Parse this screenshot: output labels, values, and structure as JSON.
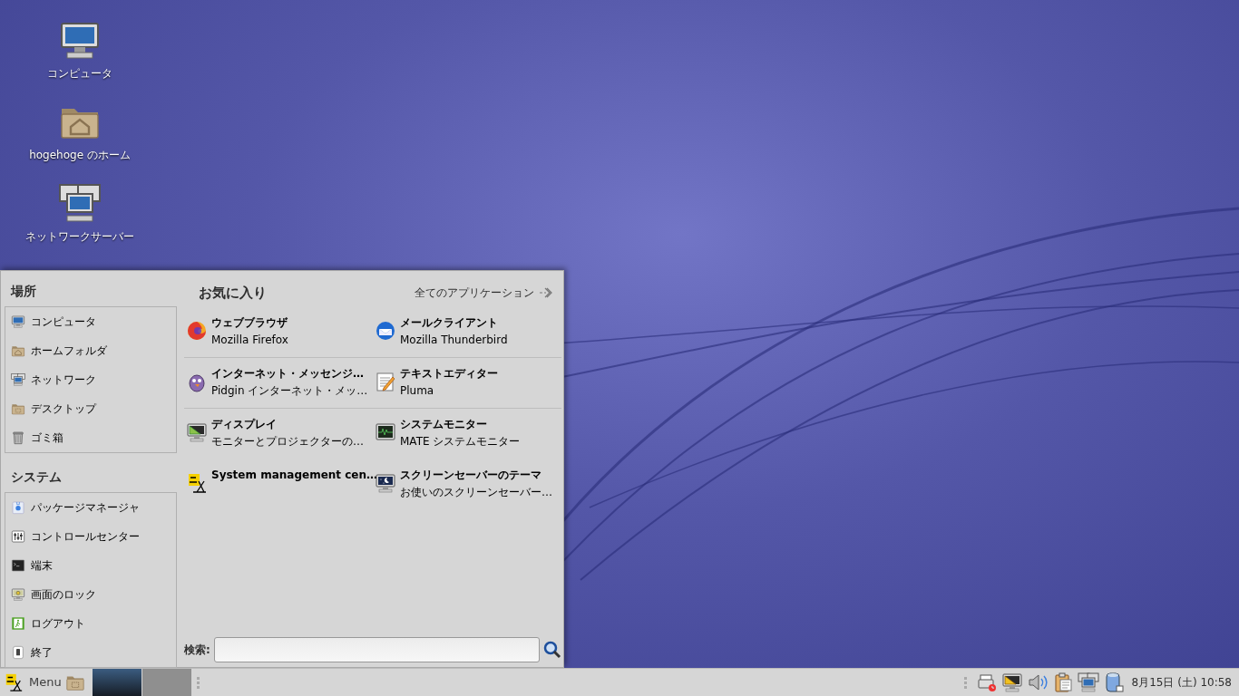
{
  "desktop_icons": [
    {
      "label": "コンピュータ",
      "kind": "computer"
    },
    {
      "label": "hogehoge のホーム",
      "kind": "home"
    },
    {
      "label": "ネットワークサーバー",
      "kind": "network"
    }
  ],
  "menu": {
    "places_title": "場所",
    "places": [
      {
        "label": "コンピュータ",
        "kind": "computer"
      },
      {
        "label": "ホームフォルダ",
        "kind": "home"
      },
      {
        "label": "ネットワーク",
        "kind": "network"
      },
      {
        "label": "デスクトップ",
        "kind": "desktop"
      },
      {
        "label": "ゴミ箱",
        "kind": "trash"
      }
    ],
    "system_title": "システム",
    "system": [
      {
        "label": "パッケージマネージャ",
        "kind": "package"
      },
      {
        "label": "コントロールセンター",
        "kind": "control"
      },
      {
        "label": "端末",
        "kind": "terminal"
      },
      {
        "label": "画面のロック",
        "kind": "lock"
      },
      {
        "label": "ログアウト",
        "kind": "logout"
      },
      {
        "label": "終了",
        "kind": "power"
      }
    ],
    "favorites_title": "お気に入り",
    "all_apps_link": "全てのアプリケーション",
    "favorite_rows": [
      {
        "divider": true,
        "items": [
          {
            "title": "ウェブブラウザ",
            "subtitle": "Mozilla Firefox",
            "kind": "browser"
          },
          {
            "title": "メールクライアント",
            "subtitle": "Mozilla Thunderbird",
            "kind": "mail"
          }
        ]
      },
      {
        "divider": true,
        "items": [
          {
            "title": "インターネット・メッセンジ…",
            "subtitle": "Pidgin インターネット・メッ…",
            "kind": "messenger"
          },
          {
            "title": "テキストエディター",
            "subtitle": "Pluma",
            "kind": "editor"
          }
        ]
      },
      {
        "divider": false,
        "items": [
          {
            "title": "ディスプレイ",
            "subtitle": "モニターとプロジェクターの…",
            "kind": "display"
          },
          {
            "title": "システムモニター",
            "subtitle": "MATE システムモニター",
            "kind": "monitor"
          }
        ]
      },
      {
        "divider": false,
        "items": [
          {
            "title": "System management cen…",
            "kind": "alt"
          },
          {
            "title": "スクリーンセーバーのテーマ",
            "subtitle": "お使いのスクリーンセーバー…",
            "kind": "screensaver"
          }
        ]
      }
    ],
    "search_label": "検索:"
  },
  "taskbar": {
    "menu_label": "Menu",
    "clock": "8月15日 (土) 10:58"
  }
}
